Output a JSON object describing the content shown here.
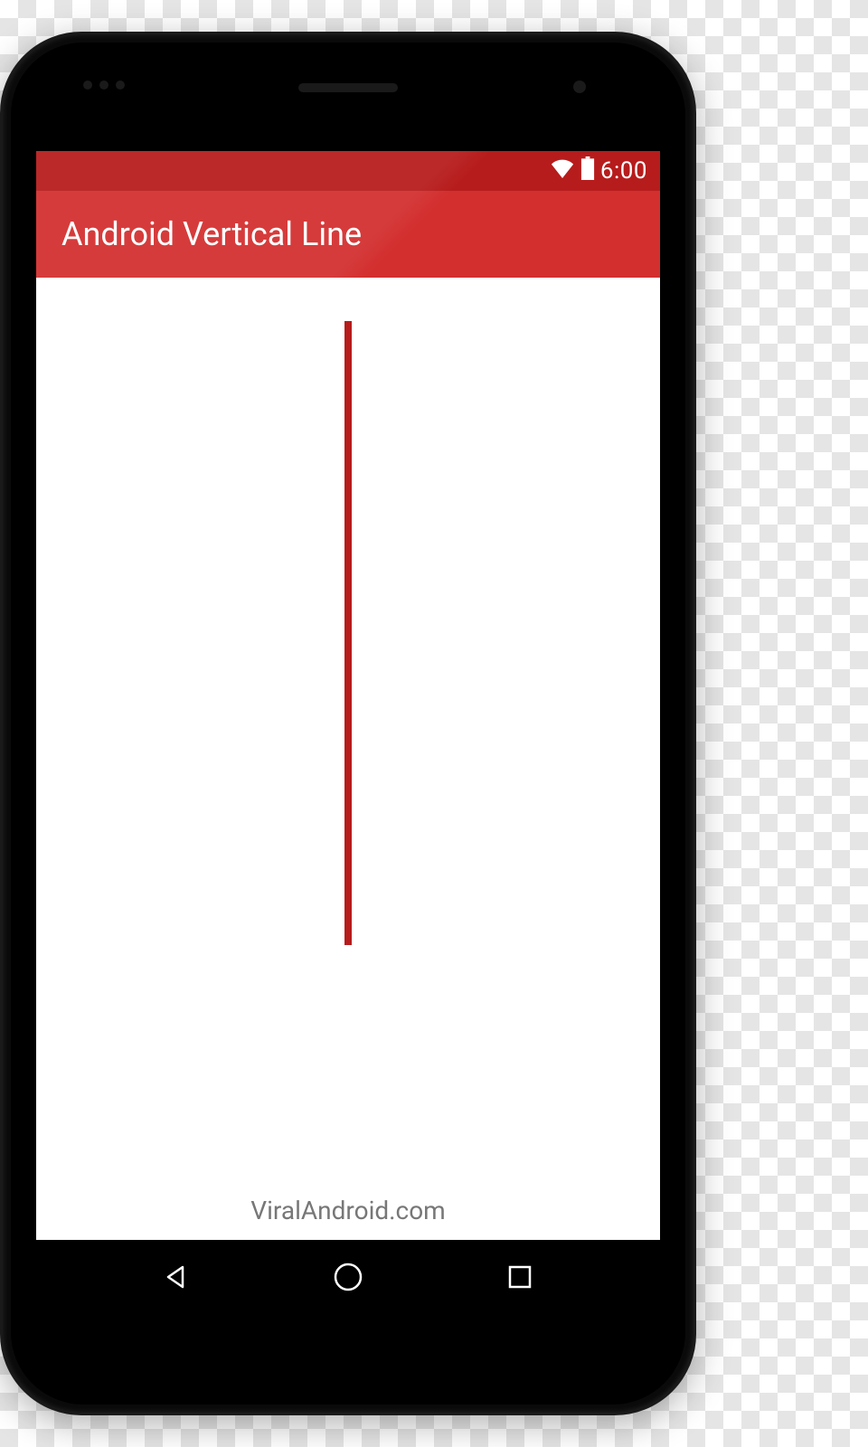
{
  "status_bar": {
    "time": "6:00",
    "wifi_icon": "wifi-icon",
    "battery_icon": "battery-icon"
  },
  "app_bar": {
    "title": "Android Vertical Line"
  },
  "content": {
    "line_color": "#b71c1c",
    "footer_text": "ViralAndroid.com"
  },
  "nav_bar": {
    "back_icon": "back-triangle",
    "home_icon": "home-circle",
    "recent_icon": "recent-square"
  }
}
